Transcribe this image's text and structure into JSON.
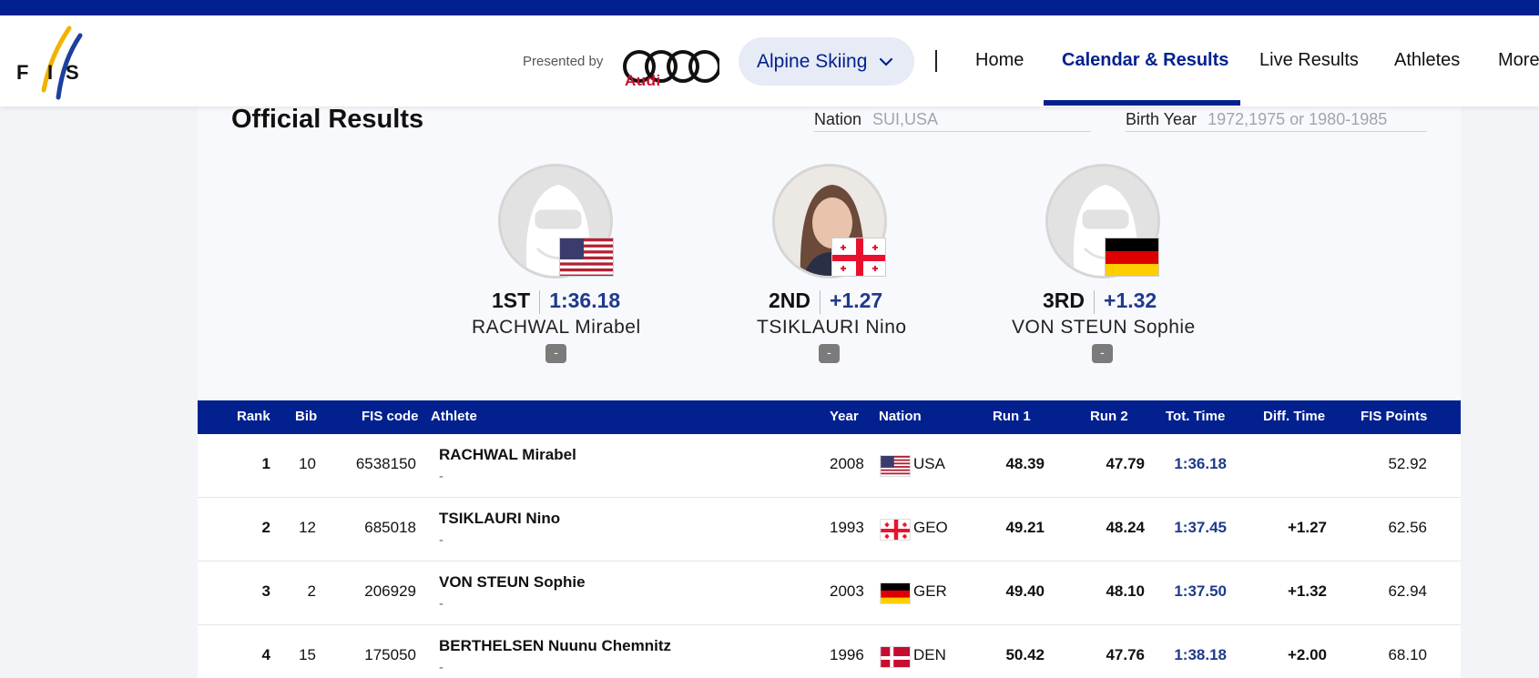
{
  "header": {
    "presented_by": "Presented by",
    "sponsor": "Audi",
    "sport_select": "Alpine Skiing",
    "nav": [
      {
        "label": "Home",
        "active": false
      },
      {
        "label": "Calendar & Results",
        "active": true
      },
      {
        "label": "Live Results",
        "active": false
      },
      {
        "label": "Athletes",
        "active": false
      },
      {
        "label": "More",
        "active": false
      }
    ]
  },
  "main": {
    "title": "Official Results",
    "filters": {
      "nation": {
        "label": "Nation",
        "placeholder": "SUI,USA"
      },
      "birth_year": {
        "label": "Birth Year",
        "placeholder": "1972,1975 or 1980-1985"
      }
    },
    "podium": [
      {
        "rank": "1ST",
        "time": "1:36.18",
        "name": "RACHWAL Mirabel",
        "badge": "-",
        "flag": "usa-flag",
        "photo": "default-avatar-icon"
      },
      {
        "rank": "2ND",
        "time": "+1.27",
        "name": "TSIKLAURI Nino",
        "badge": "-",
        "flag": "georgia-flag",
        "photo": "athlete-photo"
      },
      {
        "rank": "3RD",
        "time": "+1.32",
        "name": "VON STEUN Sophie",
        "badge": "-",
        "flag": "germany-flag",
        "photo": "default-avatar-icon"
      }
    ],
    "table": {
      "headers": {
        "rank": "Rank",
        "bib": "Bib",
        "fis_code": "FIS code",
        "athlete": "Athlete",
        "year": "Year",
        "nation": "Nation",
        "run1": "Run 1",
        "run2": "Run 2",
        "tot_time": "Tot. Time",
        "diff_time": "Diff. Time",
        "fis_points": "FIS Points"
      },
      "rows": [
        {
          "rank": "1",
          "bib": "10",
          "fis_code": "6538150",
          "athlete": "RACHWAL Mirabel",
          "sub": "-",
          "year": "2008",
          "nation": "USA",
          "run1": "48.39",
          "run2": "47.79",
          "tot_time": "1:36.18",
          "diff_time": "",
          "fis_points": "52.92"
        },
        {
          "rank": "2",
          "bib": "12",
          "fis_code": "685018",
          "athlete": "TSIKLAURI Nino",
          "sub": "-",
          "year": "1993",
          "nation": "GEO",
          "run1": "49.21",
          "run2": "48.24",
          "tot_time": "1:37.45",
          "diff_time": "+1.27",
          "fis_points": "62.56"
        },
        {
          "rank": "3",
          "bib": "2",
          "fis_code": "206929",
          "athlete": "VON STEUN Sophie",
          "sub": "-",
          "year": "2003",
          "nation": "GER",
          "run1": "49.40",
          "run2": "48.10",
          "tot_time": "1:37.50",
          "diff_time": "+1.32",
          "fis_points": "62.94"
        },
        {
          "rank": "4",
          "bib": "15",
          "fis_code": "175050",
          "athlete": "BERTHELSEN Nuunu Chemnitz",
          "sub": "-",
          "year": "1996",
          "nation": "DEN",
          "run1": "50.42",
          "run2": "47.76",
          "tot_time": "1:38.18",
          "diff_time": "+2.00",
          "fis_points": "68.10"
        }
      ]
    }
  },
  "colors": {
    "brand_blue": "#02218f",
    "time_blue": "#1f3a8a",
    "audi_red": "#c8102e"
  }
}
